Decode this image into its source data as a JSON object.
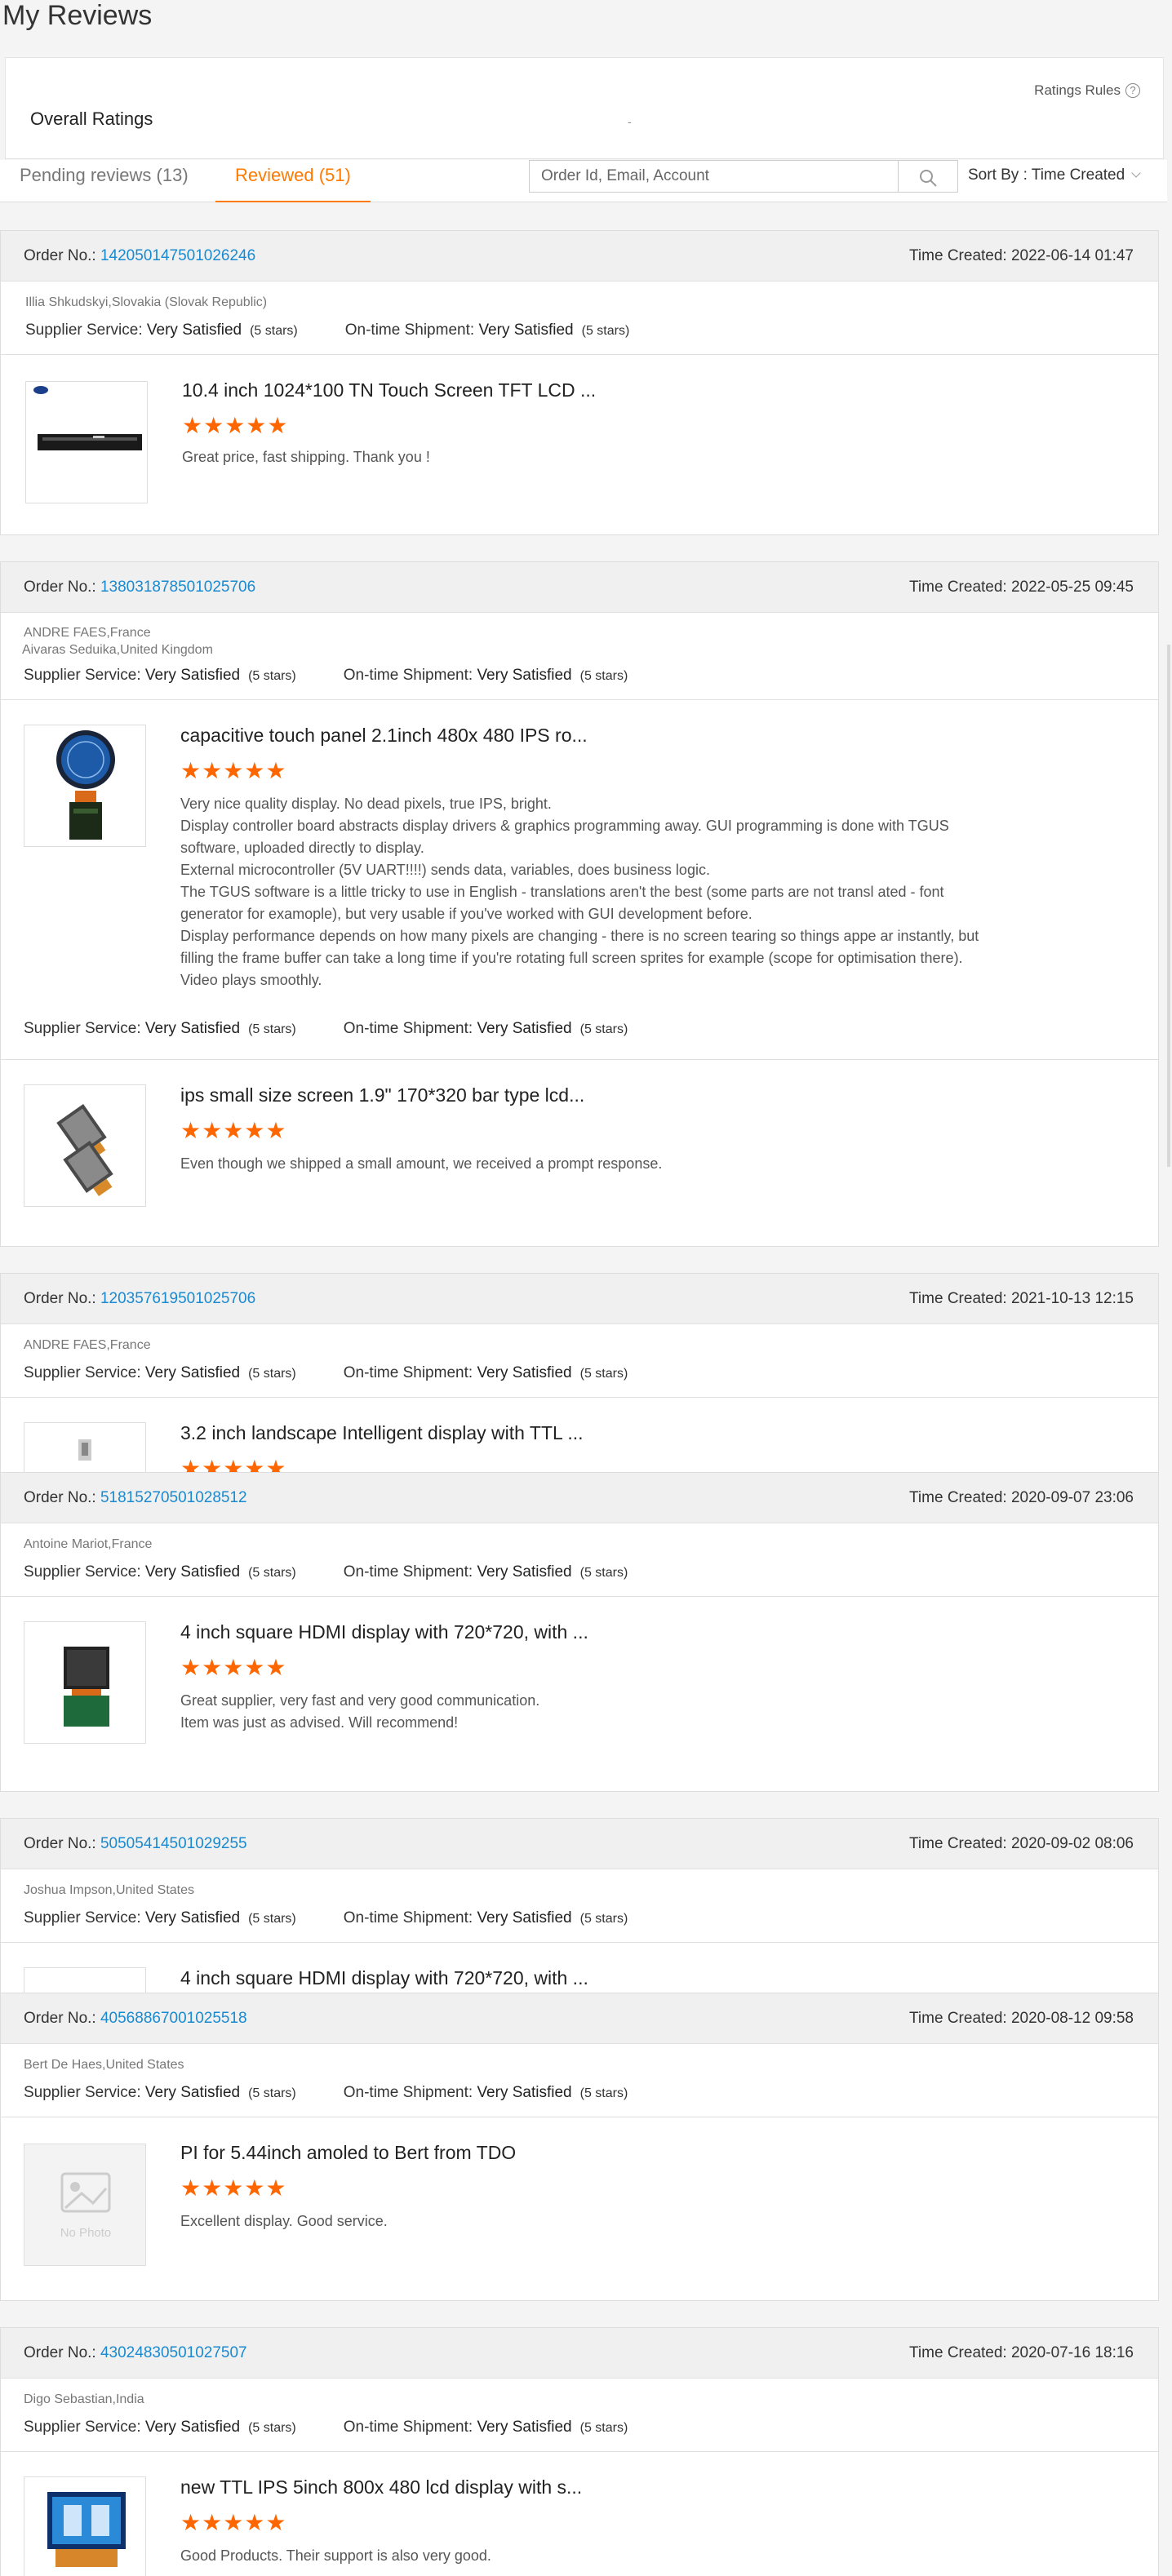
{
  "page": {
    "title": "My Reviews"
  },
  "panel": {
    "ratings_rules": "Ratings Rules",
    "help": "?",
    "overall_ratings": "Overall Ratings",
    "dash": "-"
  },
  "tabs": {
    "pending": "Pending reviews (13)",
    "reviewed": "Reviewed (51)"
  },
  "search": {
    "placeholder": "Order Id, Email, Account"
  },
  "sort": {
    "label": "Sort By : Time Created"
  },
  "labels": {
    "order_no": "Order No.:",
    "time_created": "Time Created:",
    "supplier_service": "Supplier Service:",
    "ontime_shipment": "On-time Shipment:",
    "very_satisfied": "Very Satisfied",
    "five_stars": "(5 stars)",
    "stars": "★★★★★",
    "no_photo": "No Photo"
  },
  "orders": [
    {
      "order_no": "142050147501026246",
      "time": "2022-06-14 01:47",
      "buyer": "Illia Shkudskyi,Slovakia (Slovak Republic)",
      "item": {
        "title": "10.4 inch 1024*100 TN Touch Screen TFT LCD ...",
        "comment": "Great price, fast shipping. Thank you !"
      }
    },
    {
      "order_no": "138031878501025706",
      "time": "2022-05-25 09:45",
      "buyer": "ANDRE FAES,France",
      "buyer2": "Aivaras Seduika,United Kingdom",
      "item": {
        "title": "capacitive touch panel 2.1inch 480x 480 IPS ro...",
        "comment": "Very nice quality display. No dead pixels, true IPS, bright.\nDisplay controller board abstracts display drivers & graphics programming away. GUI programming is done with TGUS software, uploaded directly to display.\nExternal microcontroller (5V UART!!!!) sends data, variables, does business logic.\nThe TGUS software is a little tricky to use in English - translations aren't the best (some parts are not transl ated - font generator for examople), but very usable if you've worked with GUI development before.\nDisplay performance depends on how many pixels are changing - there is no screen tearing so things appe ar instantly, but filling the frame buffer can take a long time if you're rotating full screen sprites for example (scope for optimisation there).\nVideo plays smoothly."
      },
      "item2": {
        "title": "ips small size screen 1.9\" 170*320 bar type lcd...",
        "comment": "Even though we shipped a small amount, we received a prompt response."
      }
    },
    {
      "order_no": "120357619501025706",
      "time": "2021-10-13 12:15",
      "buyer": "ANDRE FAES,France",
      "item": {
        "title": "3.2 inch landscape Intelligent display with TTL ..."
      }
    },
    {
      "order_no": "51815270501028512",
      "time": "2020-09-07 23:06",
      "buyer": "Antoine Mariot,France",
      "item": {
        "title": "4 inch square HDMI display with 720*720, with ...",
        "comment": "Great supplier, very fast and very good communication.\nItem was just as advised. Will recommend!"
      }
    },
    {
      "order_no": "50505414501029255",
      "time": "2020-09-02 08:06",
      "buyer": "Joshua Impson,United States",
      "item": {
        "title": "4 inch square HDMI display with 720*720, with ..."
      }
    },
    {
      "order_no": "40568867001025518",
      "time": "2020-08-12 09:58",
      "buyer": "Bert De Haes,United States",
      "item": {
        "title": "PI for 5.44inch amoled to Bert from TDO",
        "comment": "Excellent display. Good service."
      }
    },
    {
      "order_no": "43024830501027507",
      "time": "2020-07-16 18:16",
      "buyer": "Digo Sebastian,India",
      "item": {
        "title": "new TTL IPS 5inch 800x 480 lcd display with s...",
        "comment": "Good Products. Their support is also very good."
      }
    }
  ]
}
